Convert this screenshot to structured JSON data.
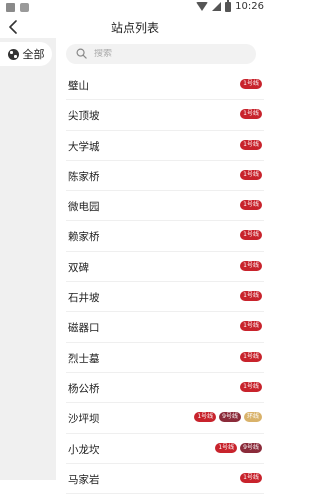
{
  "status_bar": {
    "time": "10:26"
  },
  "header": {
    "title": "站点列表"
  },
  "sidebar": {
    "items": [
      {
        "label": "全部"
      }
    ]
  },
  "search": {
    "placeholder": "搜索"
  },
  "colors": {
    "line1": "#c8232c",
    "line3": "#8b2b3a",
    "line9": "#d9b26a"
  },
  "stations": [
    {
      "name": "璧山",
      "lines": [
        "1号线"
      ]
    },
    {
      "name": "尖顶坡",
      "lines": [
        "1号线"
      ]
    },
    {
      "name": "大学城",
      "lines": [
        "1号线"
      ]
    },
    {
      "name": "陈家桥",
      "lines": [
        "1号线"
      ]
    },
    {
      "name": "微电园",
      "lines": [
        "1号线"
      ]
    },
    {
      "name": "赖家桥",
      "lines": [
        "1号线"
      ]
    },
    {
      "name": "双碑",
      "lines": [
        "1号线"
      ]
    },
    {
      "name": "石井坡",
      "lines": [
        "1号线"
      ]
    },
    {
      "name": "磁器口",
      "lines": [
        "1号线"
      ]
    },
    {
      "name": "烈士墓",
      "lines": [
        "1号线"
      ]
    },
    {
      "name": "杨公桥",
      "lines": [
        "1号线"
      ]
    },
    {
      "name": "沙坪坝",
      "lines": [
        "1号线",
        "9号线",
        "环线"
      ]
    },
    {
      "name": "小龙坎",
      "lines": [
        "1号线",
        "9号线"
      ]
    },
    {
      "name": "马家岩",
      "lines": [
        "1号线"
      ]
    }
  ]
}
